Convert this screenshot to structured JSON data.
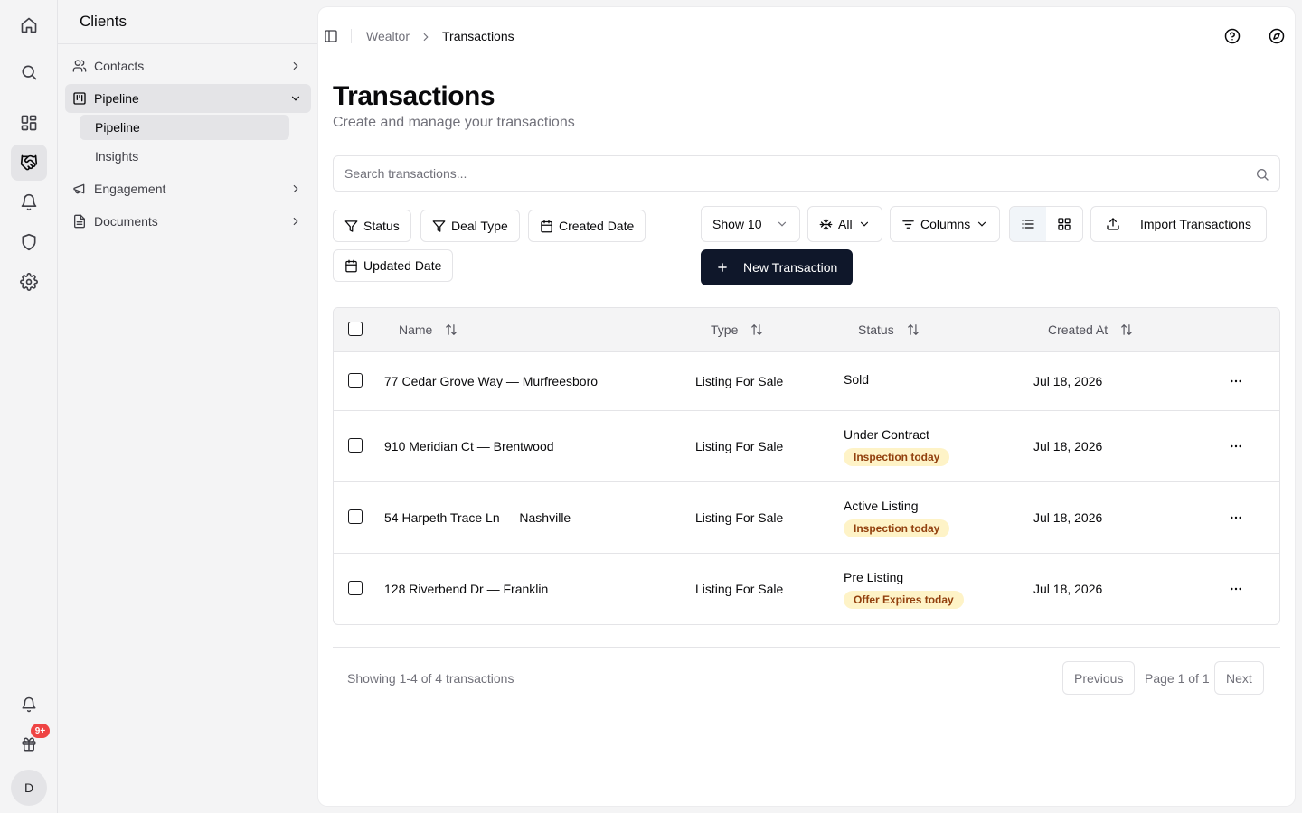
{
  "rail": {
    "badge": "9+",
    "avatar_initial": "D",
    "icons": [
      "home-icon",
      "search-icon",
      "dashboard-icon",
      "handshake-icon",
      "bell-icon",
      "shield-icon",
      "gear-icon",
      "bell-icon",
      "gift-icon"
    ]
  },
  "sidebar": {
    "title": "Clients",
    "items": [
      {
        "label": "Contacts"
      },
      {
        "label": "Pipeline"
      },
      {
        "label": "Engagement"
      },
      {
        "label": "Documents"
      }
    ],
    "subitems": [
      {
        "label": "Pipeline"
      },
      {
        "label": "Insights"
      }
    ]
  },
  "breadcrumb": {
    "root": "Wealtor",
    "current": "Transactions"
  },
  "page": {
    "title": "Transactions",
    "subtitle": "Create and manage your transactions"
  },
  "search": {
    "placeholder": "Search transactions...",
    "value": ""
  },
  "filters": {
    "status": "Status",
    "deal_type": "Deal Type",
    "created_date": "Created Date",
    "updated_date": "Updated Date"
  },
  "toolbar": {
    "show": "Show 10",
    "all": "All",
    "columns": "Columns",
    "import": "Import Transactions",
    "new": "New Transaction"
  },
  "table": {
    "columns": [
      "Name",
      "Type",
      "Status",
      "Created At"
    ],
    "rows": [
      {
        "name": "77 Cedar Grove Way — Murfreesboro",
        "type": "Listing For Sale",
        "status": "Sold",
        "badge": "",
        "created": "Jul 18, 2026"
      },
      {
        "name": "910 Meridian Ct — Brentwood",
        "type": "Listing For Sale",
        "status": "Under Contract",
        "badge": "Inspection today",
        "created": "Jul 18, 2026"
      },
      {
        "name": "54 Harpeth Trace Ln — Nashville",
        "type": "Listing For Sale",
        "status": "Active Listing",
        "badge": "Inspection today",
        "created": "Jul 18, 2026"
      },
      {
        "name": "128 Riverbend Dr — Franklin",
        "type": "Listing For Sale",
        "status": "Pre Listing",
        "badge": "Offer Expires today",
        "created": "Jul 18, 2026"
      }
    ]
  },
  "pagination": {
    "summary": "Showing 1-4 of 4 transactions",
    "previous": "Previous",
    "page": "Page 1 of 1",
    "next": "Next"
  },
  "colors": {
    "primary": "#0f172a",
    "badge_bg": "#fef3c7",
    "badge_text": "#92400e",
    "notification": "#ef4444"
  }
}
